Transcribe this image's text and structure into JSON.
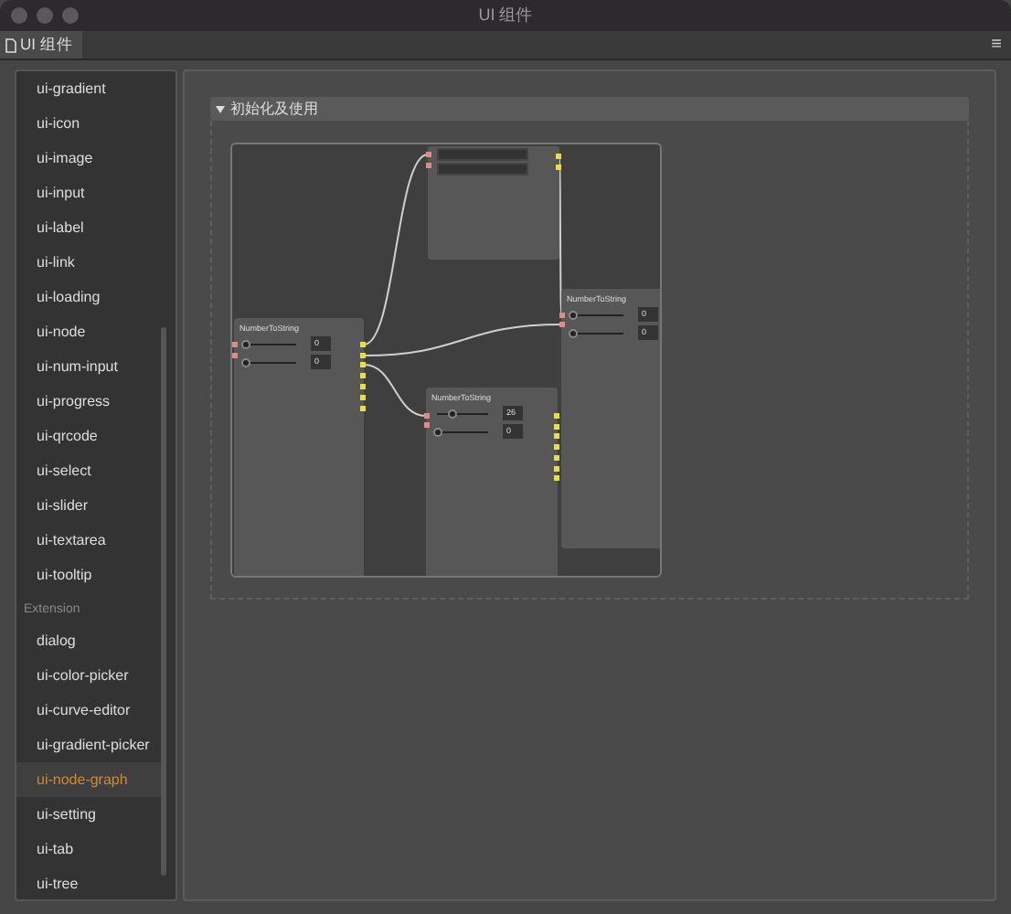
{
  "window": {
    "title": "UI 组件"
  },
  "tabs": [
    {
      "label": "UI 组件",
      "selected": true
    }
  ],
  "menu_button": "≡",
  "sidebar": {
    "items": [
      {
        "kind": "item",
        "label": "ui-gradient",
        "selected": false
      },
      {
        "kind": "item",
        "label": "ui-icon",
        "selected": false
      },
      {
        "kind": "item",
        "label": "ui-image",
        "selected": false
      },
      {
        "kind": "item",
        "label": "ui-input",
        "selected": false
      },
      {
        "kind": "item",
        "label": "ui-label",
        "selected": false
      },
      {
        "kind": "item",
        "label": "ui-link",
        "selected": false
      },
      {
        "kind": "item",
        "label": "ui-loading",
        "selected": false
      },
      {
        "kind": "item",
        "label": "ui-node",
        "selected": false
      },
      {
        "kind": "item",
        "label": "ui-num-input",
        "selected": false
      },
      {
        "kind": "item",
        "label": "ui-progress",
        "selected": false
      },
      {
        "kind": "item",
        "label": "ui-qrcode",
        "selected": false
      },
      {
        "kind": "item",
        "label": "ui-select",
        "selected": false
      },
      {
        "kind": "item",
        "label": "ui-slider",
        "selected": false
      },
      {
        "kind": "item",
        "label": "ui-textarea",
        "selected": false
      },
      {
        "kind": "item",
        "label": "ui-tooltip",
        "selected": false
      },
      {
        "kind": "heading",
        "label": "Extension"
      },
      {
        "kind": "item",
        "label": "dialog",
        "selected": false
      },
      {
        "kind": "item",
        "label": "ui-color-picker",
        "selected": false
      },
      {
        "kind": "item",
        "label": "ui-curve-editor",
        "selected": false
      },
      {
        "kind": "item",
        "label": "ui-gradient-picker",
        "selected": false
      },
      {
        "kind": "item",
        "label": "ui-node-graph",
        "selected": true
      },
      {
        "kind": "item",
        "label": "ui-setting",
        "selected": false
      },
      {
        "kind": "item",
        "label": "ui-tab",
        "selected": false
      },
      {
        "kind": "item",
        "label": "ui-tree",
        "selected": false
      }
    ]
  },
  "section": {
    "title": "初始化及使用",
    "expanded": true,
    "graph": {
      "nodes": [
        {
          "kind": "fields"
        },
        {
          "kind": "number",
          "title": "NumberToString",
          "rows": [
            {
              "level": 0,
              "value": "0"
            },
            {
              "level": 0,
              "value": "0"
            }
          ]
        },
        {
          "kind": "number",
          "title": "NumberToString",
          "rows": [
            {
              "level": 0.3,
              "value": "26"
            },
            {
              "level": 0,
              "value": "0"
            }
          ]
        },
        {
          "kind": "number",
          "title": "NumberToString",
          "rows": [
            {
              "level": 0,
              "value": "0"
            },
            {
              "level": 0,
              "value": "0"
            }
          ]
        }
      ]
    }
  }
}
